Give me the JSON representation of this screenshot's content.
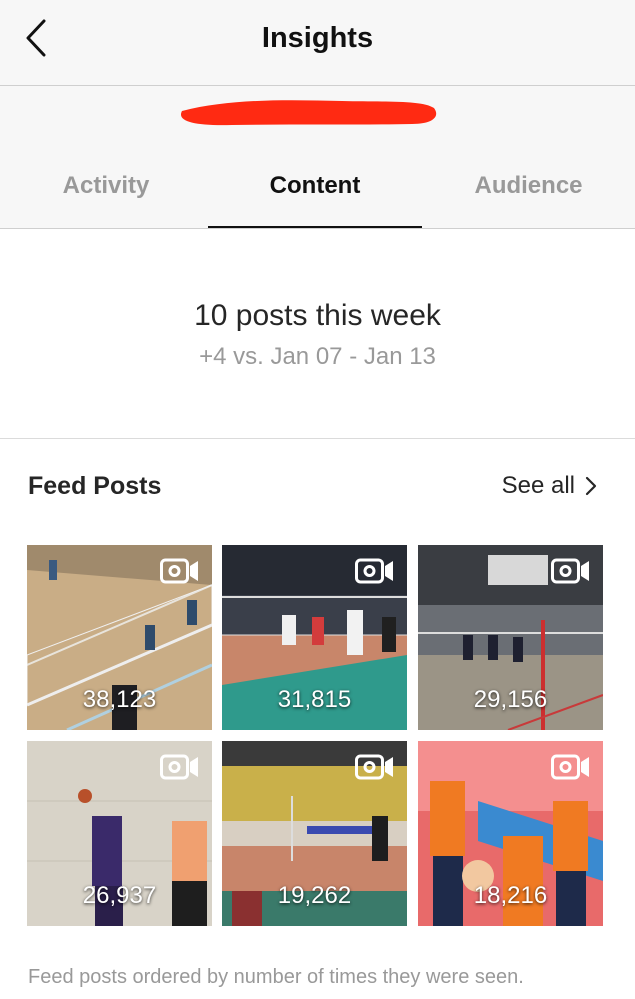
{
  "header": {
    "title": "Insights",
    "back_icon": "chevron-left-icon"
  },
  "redaction_color": "#ff2a12",
  "tabs": [
    {
      "label": "Activity",
      "active": false
    },
    {
      "label": "Content",
      "active": true
    },
    {
      "label": "Audience",
      "active": false
    }
  ],
  "summary": {
    "headline": "10 posts this week",
    "comparison": "+4 vs. Jan 07 - Jan 13"
  },
  "feed_posts": {
    "title": "Feed Posts",
    "see_all_label": "See all",
    "posts": [
      {
        "count": "38,123",
        "type": "video"
      },
      {
        "count": "31,815",
        "type": "video"
      },
      {
        "count": "29,156",
        "type": "video"
      },
      {
        "count": "26,937",
        "type": "video"
      },
      {
        "count": "19,262",
        "type": "video"
      },
      {
        "count": "18,216",
        "type": "video"
      }
    ],
    "footnote": "Feed posts ordered by number of times they were seen."
  }
}
